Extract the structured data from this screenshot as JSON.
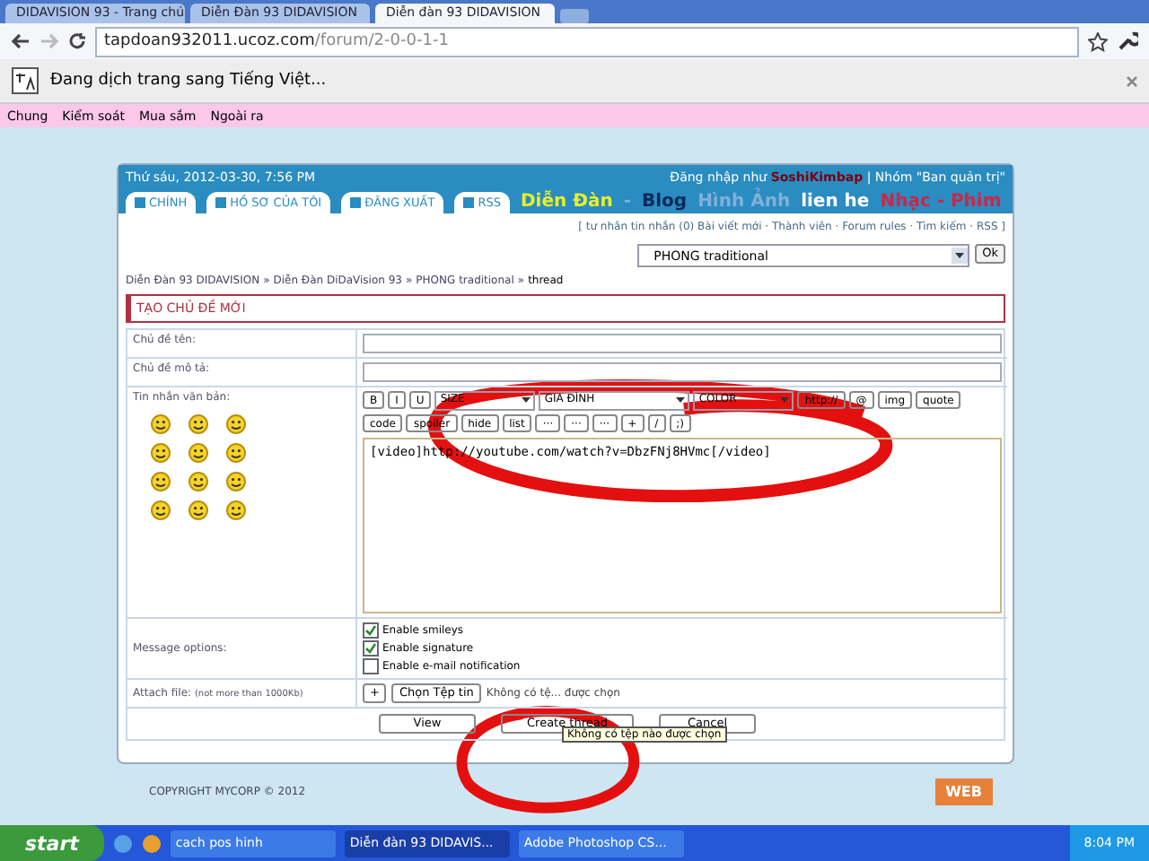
{
  "browser_tabs": [
    {
      "title": "DIDAVISION 93 - Trang chủ",
      "selected": false
    },
    {
      "title": "Diễn Đàn 93 DIDAVISION",
      "selected": false
    },
    {
      "title": "Diễn đàn 93 DIDAVISION",
      "selected": true
    }
  ],
  "address_bar": {
    "host": "tapdoan932011.ucoz.com",
    "path": "/forum/2-0-0-1-1"
  },
  "translate_bar": {
    "message": "Đang dịch trang sang Tiếng Việt..."
  },
  "bookmarks": [
    "Chung",
    "Kiểm soát",
    "Mua sắm",
    "Ngoài ra"
  ],
  "site_header": {
    "date": "Thứ sáu, 2012-03-30, 7:56 PM",
    "login_prefix": "Đăng nhập như",
    "username": "SoshiKimbap",
    "group": "| Nhóm \"Ban quản trị\""
  },
  "nav": [
    {
      "kind": "tab",
      "label": "CHÍNH"
    },
    {
      "kind": "tab",
      "label": "HỒ SƠ CỦA TÔI"
    },
    {
      "kind": "tab",
      "label": "ĐĂNG XUẤT"
    },
    {
      "kind": "tab",
      "label": "RSS"
    },
    {
      "kind": "link",
      "label": "Diễn Đàn",
      "color": "#e6ef2a"
    },
    {
      "kind": "link",
      "label": "-",
      "color": "#7fb0d8"
    },
    {
      "kind": "link",
      "label": "Blog",
      "color": "#0a2a5a"
    },
    {
      "kind": "link",
      "label": "Hình Ảnh",
      "color": "#7fb0d8"
    },
    {
      "kind": "link",
      "label": "lien he",
      "color": "#ffffff"
    },
    {
      "kind": "link",
      "label": "Nhạc - Phim",
      "color": "#c8284a"
    }
  ],
  "forum_links": "[ tư nhân tin nhắn (0) Bài viết mới · Thành viên · Forum rules · Tìm kiếm · RSS ]",
  "forum_jump": {
    "value": "PHONG traditional",
    "button": "Ok"
  },
  "breadcrumb": {
    "separator": "»",
    "items": [
      "Diễn Đàn 93 DIDAVISION",
      "Diễn Đàn DiDaVision 93",
      "PHONG traditional",
      "thread"
    ]
  },
  "form": {
    "title": "TẠO CHỦ ĐỀ MỚI",
    "subject_label": "Chủ đề tên:",
    "description_label": "Chủ đề mô tả:",
    "message_label": "Tin nhắn văn bản:",
    "toolbar": [
      {
        "kind": "button",
        "label": "B"
      },
      {
        "kind": "button",
        "label": "I"
      },
      {
        "kind": "button",
        "label": "U"
      },
      {
        "kind": "select",
        "label": "SIZE"
      },
      {
        "kind": "select",
        "label": "GIA ĐÌNH"
      },
      {
        "kind": "select",
        "label": "COLOR"
      },
      {
        "kind": "button",
        "label": "http://"
      },
      {
        "kind": "button",
        "label": "@"
      },
      {
        "kind": "button",
        "label": "img"
      },
      {
        "kind": "button",
        "label": "quote"
      },
      {
        "kind": "button",
        "label": "code"
      },
      {
        "kind": "button",
        "label": "spoiler"
      },
      {
        "kind": "button",
        "label": "hide"
      },
      {
        "kind": "button",
        "label": "list"
      },
      {
        "kind": "button",
        "label": "···"
      },
      {
        "kind": "button",
        "label": "···"
      },
      {
        "kind": "button",
        "label": "···"
      },
      {
        "kind": "button",
        "label": "+"
      },
      {
        "kind": "button",
        "label": "/"
      },
      {
        "kind": "button",
        "label": ";)"
      }
    ],
    "message_value": "[video]http://youtube.com/watch?v=DbzFNj8HVmc[/video]",
    "options_label": "Message options:",
    "options": [
      {
        "label": "Enable smileys",
        "checked": true
      },
      {
        "label": "Enable signature",
        "checked": true
      },
      {
        "label": "Enable e-mail notification",
        "checked": false
      }
    ],
    "attach_label": "Attach file:",
    "attach_note": "(not more than 1000Kb)",
    "attach_plus": "+",
    "choose_file": "Chọn Tệp tin",
    "no_file": "Không có tệ... được chọn",
    "buttons": [
      "View",
      "Create thread",
      "Cancel"
    ],
    "tooltip": "Không có tệp nào được chọn"
  },
  "footer": {
    "copyright": "COPYRIGHT MYCORP © 2012",
    "badge": "WEB"
  },
  "taskbar": {
    "start": "start",
    "windows": [
      {
        "title": "cach pos hinh",
        "selected": false
      },
      {
        "title": "Diễn đàn 93 DIDAVIS...",
        "selected": true
      },
      {
        "title": "Adobe Photoshop CS...",
        "selected": false
      }
    ],
    "clock": "8:04 PM"
  }
}
